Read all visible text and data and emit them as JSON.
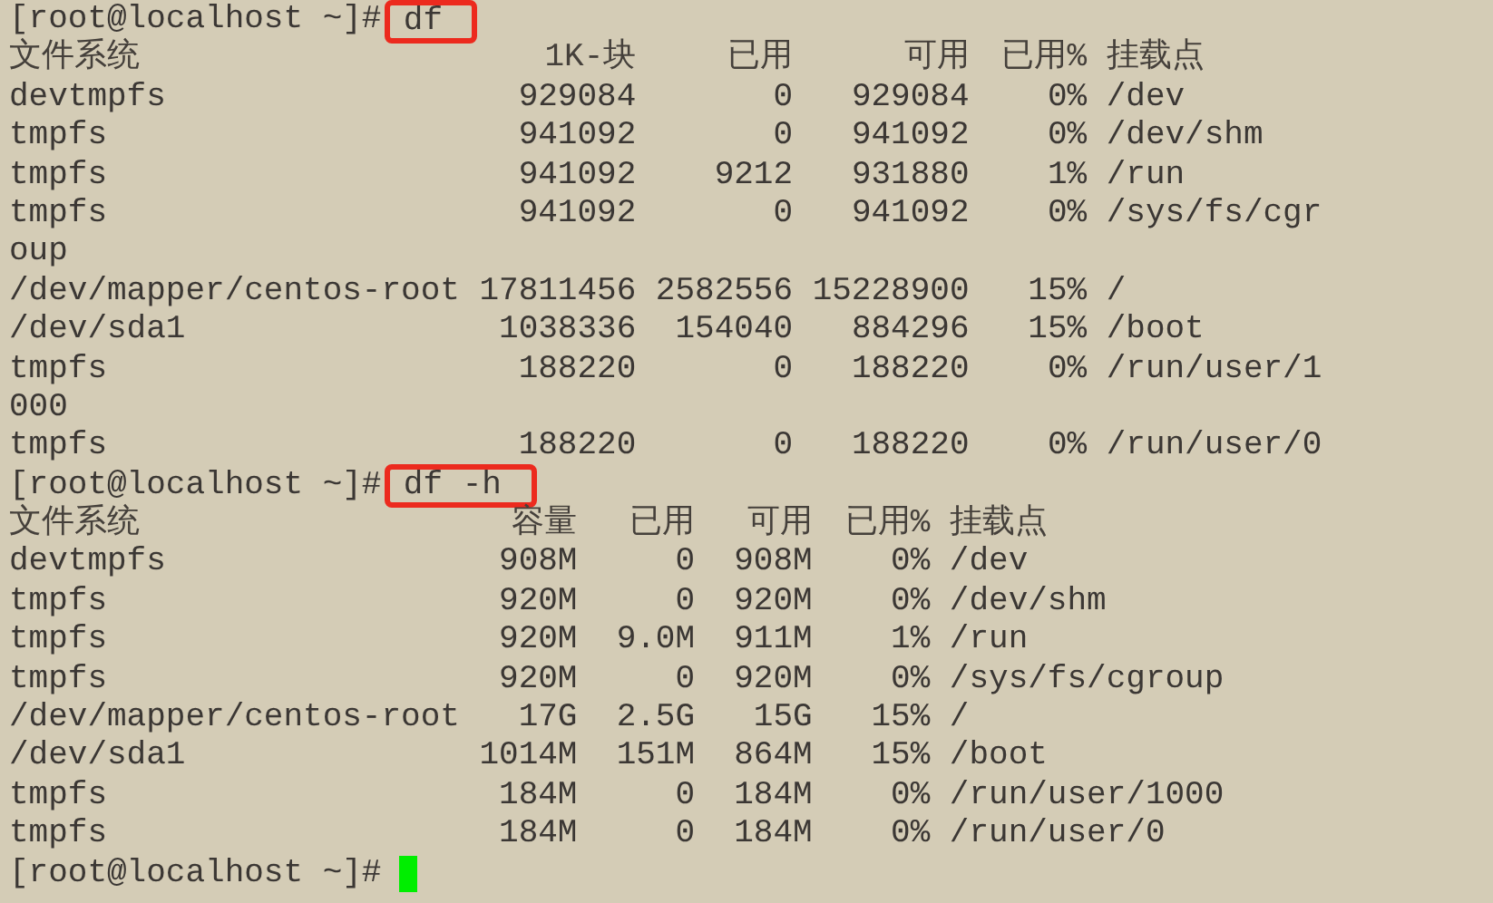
{
  "blocks": [
    {
      "kind": "prompt",
      "prompt": "[root@localhost ~]#",
      "command": "df",
      "highlighted": true
    },
    {
      "kind": "table",
      "header": [
        "文件系统",
        "1K-块",
        "已用",
        "可用",
        "已用%",
        "挂载点"
      ],
      "rows": [
        {
          "cells": [
            "devtmpfs",
            "929084",
            "0",
            "929084",
            "0%",
            "/dev"
          ]
        },
        {
          "cells": [
            "tmpfs",
            "941092",
            "0",
            "941092",
            "0%",
            "/dev/shm"
          ]
        },
        {
          "cells": [
            "tmpfs",
            "941092",
            "9212",
            "931880",
            "1%",
            "/run"
          ]
        },
        {
          "cells": [
            "tmpfs",
            "941092",
            "0",
            "941092",
            "0%",
            "/sys/fs/cgr"
          ],
          "wrap": "oup"
        },
        {
          "cells": [
            "/dev/mapper/centos-root",
            "17811456",
            "2582556",
            "15228900",
            "15%",
            "/"
          ]
        },
        {
          "cells": [
            "/dev/sda1",
            "1038336",
            "154040",
            "884296",
            "15%",
            "/boot"
          ]
        },
        {
          "cells": [
            "tmpfs",
            "188220",
            "0",
            "188220",
            "0%",
            "/run/user/1"
          ],
          "wrap": "000"
        },
        {
          "cells": [
            "tmpfs",
            "188220",
            "0",
            "188220",
            "0%",
            "/run/user/0"
          ]
        }
      ]
    },
    {
      "kind": "prompt",
      "prompt": "[root@localhost ~]#",
      "command": "df -h",
      "highlighted": true
    },
    {
      "kind": "table",
      "header": [
        "文件系统",
        "容量",
        "已用",
        "可用",
        "已用%",
        "挂载点"
      ],
      "rows": [
        {
          "cells": [
            "devtmpfs",
            "908M",
            "0",
            "908M",
            "0%",
            "/dev"
          ]
        },
        {
          "cells": [
            "tmpfs",
            "920M",
            "0",
            "920M",
            "0%",
            "/dev/shm"
          ]
        },
        {
          "cells": [
            "tmpfs",
            "920M",
            "9.0M",
            "911M",
            "1%",
            "/run"
          ]
        },
        {
          "cells": [
            "tmpfs",
            "920M",
            "0",
            "920M",
            "0%",
            "/sys/fs/cgroup"
          ]
        },
        {
          "cells": [
            "/dev/mapper/centos-root",
            "17G",
            "2.5G",
            "15G",
            "15%",
            "/"
          ]
        },
        {
          "cells": [
            "/dev/sda1",
            "1014M",
            "151M",
            "864M",
            "15%",
            "/boot"
          ]
        },
        {
          "cells": [
            "tmpfs",
            "184M",
            "0",
            "184M",
            "0%",
            "/run/user/1000"
          ]
        },
        {
          "cells": [
            "tmpfs",
            "184M",
            "0",
            "184M",
            "0%",
            "/run/user/0"
          ]
        }
      ]
    },
    {
      "kind": "prompt",
      "prompt": "[root@localhost ~]#",
      "cursor": true
    }
  ]
}
